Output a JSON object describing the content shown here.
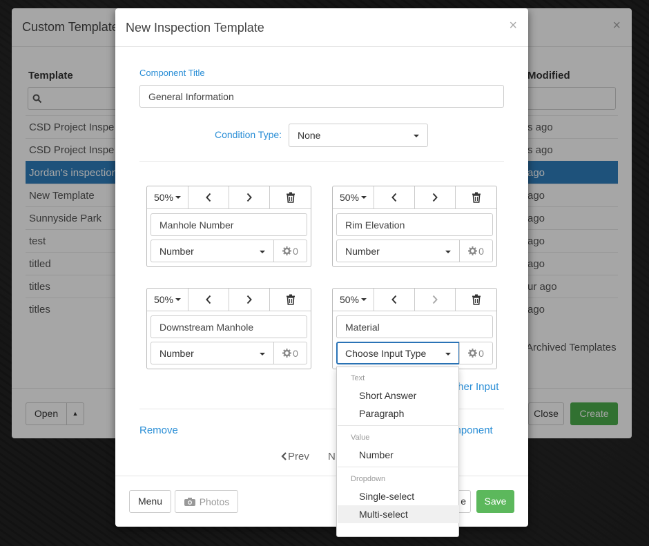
{
  "background_modal": {
    "title": "Custom Templates",
    "close": "×",
    "col_template": "Template",
    "col_modified": "Modified",
    "rows": [
      {
        "name": "CSD Project Inspe",
        "time": "s ago"
      },
      {
        "name": "CSD Project Inspe",
        "time": "s ago"
      },
      {
        "name": "Jordan's inspection",
        "time": "ago"
      },
      {
        "name": "New Template",
        "time": "ago"
      },
      {
        "name": "Sunnyside Park",
        "time": "ago"
      },
      {
        "name": "test",
        "time": "ago"
      },
      {
        "name": "titled",
        "time": "ago"
      },
      {
        "name": "titles",
        "time": "ur ago"
      },
      {
        "name": "titles",
        "time": "ago"
      }
    ],
    "selected_row": 2,
    "archived": "Archived Templates",
    "open_label": "Open",
    "close_label": "Close",
    "create_label": "Create"
  },
  "modal": {
    "title": "New Inspection Template",
    "close": "×",
    "component_title_label": "Component Title",
    "component_title_value": "General Information",
    "condition_type_label": "Condition Type:",
    "condition_type_value": "None",
    "cards": [
      {
        "width": "50%",
        "name": "Manhole Number",
        "type": "Number",
        "count": "0",
        "next_disabled": false
      },
      {
        "width": "50%",
        "name": "Rim Elevation",
        "type": "Number",
        "count": "0",
        "next_disabled": false
      },
      {
        "width": "50%",
        "name": "Downstream Manhole",
        "type": "Number",
        "count": "0",
        "next_disabled": false
      },
      {
        "width": "50%",
        "name": "Material",
        "type": "Choose Input Type",
        "count": "0",
        "next_disabled": true
      }
    ],
    "add_input_link": "ther Input",
    "remove_link": "Remove",
    "add_component_link": "omponent",
    "prev_label": "Prev",
    "next_label": "N",
    "menu_label": "Menu",
    "photos_label": "Photos",
    "hidden_button_label": "e",
    "save_label": "Save"
  },
  "dropdown": {
    "groups": [
      {
        "label": "Text",
        "items": [
          "Short Answer",
          "Paragraph"
        ]
      },
      {
        "label": "Value",
        "items": [
          "Number"
        ]
      },
      {
        "label": "Dropdown",
        "items": [
          "Single-select",
          "Multi-select"
        ]
      }
    ],
    "hovered_item": "Multi-select"
  },
  "colors": {
    "link": "#2a8ed6",
    "selected_row": "#2e7fbd",
    "save": "#5cb85c",
    "create": "#4cae4c"
  }
}
